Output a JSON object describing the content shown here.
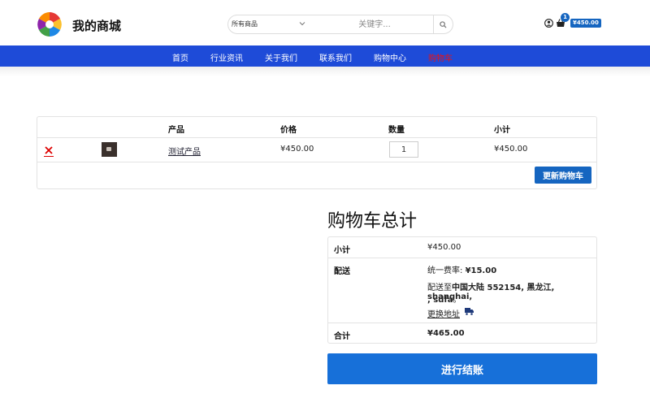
{
  "header": {
    "site_title": "我的商城",
    "search": {
      "category": "所有商品",
      "placeholder": "关键字..."
    },
    "cart_count": "1",
    "cart_total": "¥450.00"
  },
  "nav": {
    "items": [
      {
        "label": "首页"
      },
      {
        "label": "行业资讯"
      },
      {
        "label": "关于我们"
      },
      {
        "label": "联系我们"
      },
      {
        "label": "购物中心"
      },
      {
        "label": "购物车",
        "active": true
      }
    ]
  },
  "cart": {
    "columns": {
      "product": "产品",
      "price": "价格",
      "quantity": "数量",
      "subtotal": "小计"
    },
    "items": [
      {
        "name": "测试产品",
        "price": "¥450.00",
        "quantity": "1",
        "subtotal": "¥450.00"
      }
    ],
    "update_button": "更新购物车"
  },
  "totals": {
    "title": "购物车总计",
    "subtotal_label": "小计",
    "subtotal_value": "¥450.00",
    "shipping_label": "配送",
    "shipping_rate_prefix": "统一费率:",
    "shipping_rate_value": "¥15.00",
    "ship_to_prefix": "配送至",
    "ship_to_line1": "中国大陆 552154, 黑龙江, shanghai,",
    "ship_to_line2": ", sdfa",
    "ship_to_suffix": "。",
    "change_address": "更换地址",
    "total_label": "合计",
    "total_value": "¥465.00"
  },
  "checkout_button": "进行结账",
  "colors": {
    "nav_bg": "#1e4bd8",
    "accent": "#1565c0",
    "active_nav": "#e11111"
  }
}
